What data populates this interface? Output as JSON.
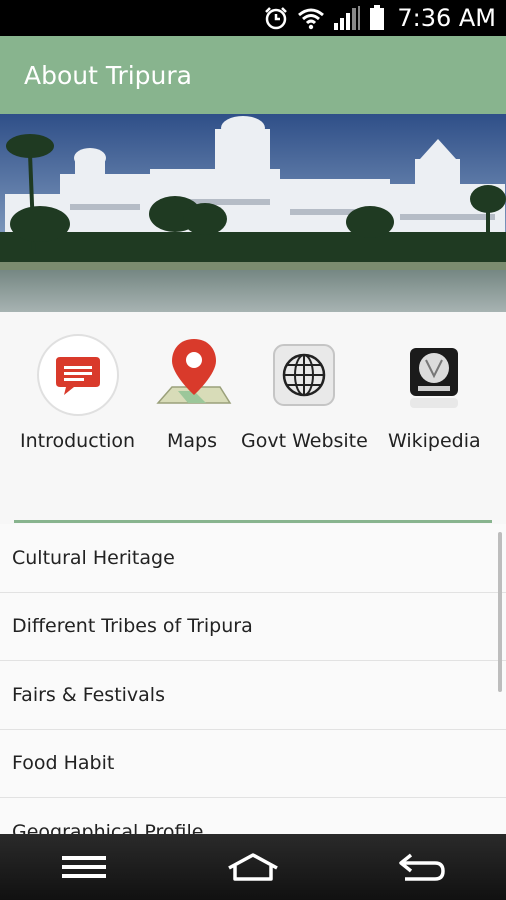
{
  "status": {
    "time": "7:36 AM"
  },
  "appbar": {
    "title": "About Tripura"
  },
  "icons": [
    {
      "label": "Introduction",
      "icon": "speech-bubble-icon"
    },
    {
      "label": "Maps",
      "icon": "map-pin-icon"
    },
    {
      "label": "Govt Website",
      "icon": "globe-icon"
    },
    {
      "label": "Wikipedia",
      "icon": "wikipedia-icon"
    }
  ],
  "list": {
    "items": [
      "Cultural Heritage",
      "Different Tribes of Tripura",
      "Fairs & Festivals",
      "Food Habit",
      "Geographical Profile"
    ]
  },
  "colors": {
    "appbar": "#88b48e",
    "accent_red": "#d93a2b"
  }
}
